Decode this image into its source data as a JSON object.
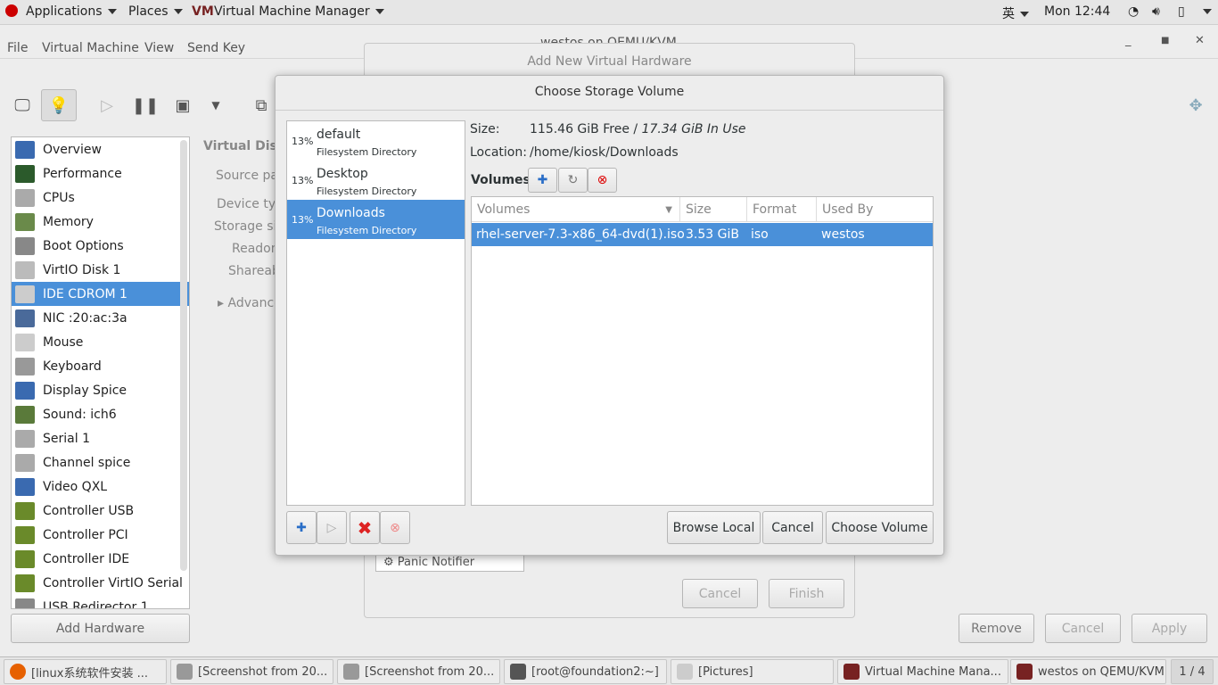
{
  "topbar": {
    "applications": "Applications",
    "places": "Places",
    "app": "Virtual Machine Manager",
    "input_method": "英",
    "clock": "Mon 12:44"
  },
  "main": {
    "title": "westos on QEMU/KVM",
    "menu": [
      "File",
      "Virtual Machine",
      "View",
      "Send Key"
    ],
    "hardware": [
      "Overview",
      "Performance",
      "CPUs",
      "Memory",
      "Boot Options",
      "VirtIO Disk 1",
      "IDE CDROM 1",
      "NIC :20:ac:3a",
      "Mouse",
      "Keyboard",
      "Display Spice",
      "Sound: ich6",
      "Serial 1",
      "Channel spice",
      "Video QXL",
      "Controller USB",
      "Controller PCI",
      "Controller IDE",
      "Controller VirtIO Serial",
      "USB Redirector 1"
    ],
    "selected": "IDE CDROM 1",
    "section_title": "Virtual Disk",
    "fields": [
      "Source pa",
      "Device typ",
      "Storage si",
      "Readon",
      "Shareab"
    ],
    "advanced": "Advance",
    "add_hardware": "Add Hardware",
    "remove": "Remove",
    "cancel": "Cancel",
    "apply": "Apply"
  },
  "add_hw": {
    "title": "Add New Virtual Hardware",
    "panic_item": "Panic Notifier",
    "cancel": "Cancel",
    "finish": "Finish"
  },
  "csv": {
    "title": "Choose Storage Volume",
    "pools": [
      {
        "pct": "13%",
        "name": "default",
        "type": "Filesystem Directory"
      },
      {
        "pct": "13%",
        "name": "Desktop",
        "type": "Filesystem Directory"
      },
      {
        "pct": "13%",
        "name": "Downloads",
        "type": "Filesystem Directory"
      }
    ],
    "size_label": "Size:",
    "size_free": "115.46 GiB Free / ",
    "size_used": "17.34 GiB In Use",
    "location_label": "Location:",
    "location": "/home/kiosk/Downloads",
    "volumes_label": "Volumes",
    "columns": [
      "Volumes",
      "Size",
      "Format",
      "Used By"
    ],
    "rows": [
      {
        "name": "rhel-server-7.3-x86_64-dvd(1).iso",
        "size": "3.53 GiB",
        "format": "iso",
        "used_by": "westos"
      }
    ],
    "browse_local": "Browse Local",
    "cancel": "Cancel",
    "choose_volume": "Choose Volume"
  },
  "taskbar": {
    "items": [
      "[linux系统软件安装 ...",
      "[Screenshot from 20...",
      "[Screenshot from 20...",
      "[root@foundation2:~]",
      "[Pictures]",
      "Virtual Machine Mana...",
      "westos on QEMU/KVM"
    ],
    "workspace": "1 / 4"
  },
  "colors": {
    "selection": "#4a90d9"
  }
}
